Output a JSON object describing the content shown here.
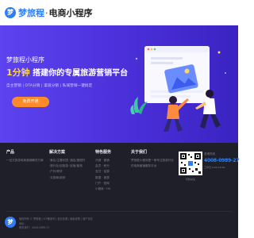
{
  "header": {
    "logo_mark": "梦",
    "brand": "梦旅程",
    "separator": "·",
    "subtitle": "电商小程序"
  },
  "hero": {
    "brand_line": "梦旅程小程序",
    "headline_highlight": "1分钟",
    "headline_rest": " 搭建你的专属旅游营销平台",
    "tags": "自主营销 | OTA分销 | 渠道分销 | 私域营销一键搞定",
    "cta_label": "免费开通"
  },
  "footer": {
    "columns": [
      {
        "title": "产品",
        "items": [
          "一站式旅游电商营销解决方案",
          "",
          "",
          "",
          ""
        ]
      },
      {
        "title": "解决方案",
        "items": [
          "·景区/主题乐园    ·酒店/度假村",
          "·旅行社/定制游    ·民宿/客栈",
          "·户外/研学",
          "·文旅局/政府",
          ""
        ]
      },
      {
        "title": "特色服务",
        "items": [
          "分销 · 营销",
          "会员 · 积分",
          "支付 · 结算",
          "数据 · 报表",
          "门户 · 官网",
          "小程序 · H5"
        ]
      },
      {
        "title": "关于我们",
        "items": [
          "梦旅程小程序是一家专注旅游行业",
          "的电商营销服务平台",
          "",
          "",
          ""
        ]
      }
    ],
    "qr_caption": "扫码关注",
    "contact_label": "咨询热线",
    "phone": "4008-0989-27",
    "hours": "工作日 9:00-18:00",
    "bottom_logo": "梦",
    "bottom_lines": [
      "版权所有 © 梦旅程  |  ICP备案号  |  营业执照  |  隐私政策  |  用户协议",
      "地址：",
      "联系我们：4008-0989-27"
    ]
  }
}
